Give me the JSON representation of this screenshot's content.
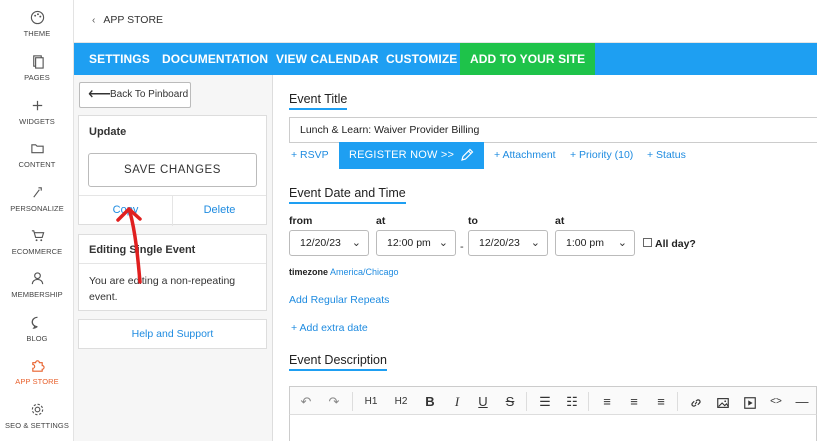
{
  "sidebar": {
    "items": [
      {
        "label": "THEME",
        "icon": "palette-icon"
      },
      {
        "label": "PAGES",
        "icon": "pages-icon"
      },
      {
        "label": "WIDGETS",
        "icon": "plus-icon"
      },
      {
        "label": "CONTENT",
        "icon": "folder-icon"
      },
      {
        "label": "PERSONALIZE",
        "icon": "personalize-icon"
      },
      {
        "label": "ECOMMERCE",
        "icon": "cart-icon"
      },
      {
        "label": "MEMBERSHIP",
        "icon": "person-icon"
      },
      {
        "label": "BLOG",
        "icon": "chat-icon"
      },
      {
        "label": "APP STORE",
        "icon": "puzzle-icon",
        "active": true
      },
      {
        "label": "SEO & SETTINGS",
        "icon": "gear-icon"
      }
    ],
    "active_color": "#e8602c"
  },
  "breadcrumb": {
    "label": "APP STORE"
  },
  "nav": {
    "settings": "SETTINGS",
    "documentation": "DOCUMENTATION",
    "view_calendar": "VIEW CALENDAR",
    "customize": "CUSTOMIZE",
    "add_to_site": "ADD TO YOUR SITE",
    "bar_color": "#1e9ff2",
    "cta_color": "#1ec34a"
  },
  "left": {
    "back": "Back To Pinboard",
    "update_title": "Update",
    "save": "SAVE CHANGES",
    "copy": "Copy",
    "delete": "Delete",
    "editing_title": "Editing Single Event",
    "editing_text": "You are editing a non-repeating event.",
    "help": "Help and Support"
  },
  "event": {
    "title_heading": "Event Title",
    "title_value": "Lunch & Learn: Waiver Provider Billing",
    "rsvp": "+ RSVP",
    "register": "REGISTER NOW >>",
    "attachment": "+ Attachment",
    "priority": "+ Priority (10)",
    "status": "+ Status",
    "datetime_heading": "Event Date and Time",
    "from_label": "from",
    "at_label": "at",
    "to_label": "to",
    "at2_label": "at",
    "from_date": "12/20/23",
    "from_time": "12:00 pm",
    "dash": "-",
    "to_date": "12/20/23",
    "to_time": "1:00 pm",
    "all_day": "All day?",
    "timezone_label": "timezone",
    "timezone_value": "America/Chicago",
    "regular_repeats": "Add Regular Repeats",
    "extra_date": "+ Add extra date",
    "description_heading": "Event Description"
  },
  "toolbar": {
    "undo": "↶",
    "redo": "↷",
    "h1": "H1",
    "h2": "H2",
    "bold": "B",
    "italic": "I",
    "underline": "U",
    "strike": "S",
    "ul": "☰",
    "ol": "☷",
    "align_left": "≡",
    "align_center": "≡",
    "align_right": "≡",
    "link": "link-icon",
    "image": "image-icon",
    "video": "video-icon",
    "code": "<>",
    "hr": "—"
  }
}
